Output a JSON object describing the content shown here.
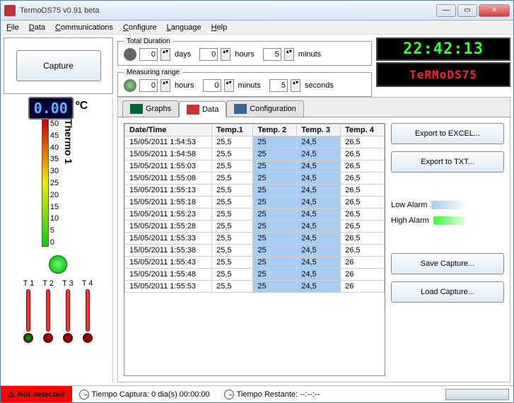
{
  "window": {
    "title": "TermoDS75 v0.91 beta"
  },
  "menu": {
    "file": "File",
    "data": "Data",
    "comm": "Communications",
    "config": "Configure",
    "lang": "Language",
    "help": "Help"
  },
  "toolbar": {
    "capture": "Capture"
  },
  "duration": {
    "total_legend": "Total Duration",
    "range_legend": "Measuring range",
    "days_lbl": "days",
    "hours_lbl": "hours",
    "minuts_lbl": "minuts",
    "seconds_lbl": "seconds",
    "total": {
      "days": "0",
      "hours": "0",
      "minuts": "5"
    },
    "range": {
      "hours": "0",
      "minuts": "0",
      "seconds": "5"
    }
  },
  "clock": {
    "time": "22:42:13"
  },
  "logo": {
    "text": "TeRMoDS75"
  },
  "thermo": {
    "reading": "0.00",
    "unit": "ºC",
    "label": "Thermo 1",
    "scale": [
      "50",
      "45",
      "40",
      "35",
      "30",
      "25",
      "20",
      "15",
      "10",
      "5",
      "0"
    ]
  },
  "minis": [
    {
      "label": "T 1",
      "color": "#0a0"
    },
    {
      "label": "T 2",
      "color": "#c00"
    },
    {
      "label": "T 3",
      "color": "#c00"
    },
    {
      "label": "T 4",
      "color": "#c00"
    }
  ],
  "tabs": {
    "graphs": "Graphs",
    "data": "Data",
    "config": "Configuration"
  },
  "table": {
    "headers": [
      "Date/Time",
      "Temp.1",
      "Temp. 2",
      "Temp. 3",
      "Temp. 4"
    ],
    "rows": [
      [
        "15/05/2011 1:54:53",
        "25,5",
        "25",
        "24,5",
        "26,5"
      ],
      [
        "15/05/2011 1:54:58",
        "25,5",
        "25",
        "24,5",
        "26,5"
      ],
      [
        "15/05/2011 1:55:03",
        "25,5",
        "25",
        "24,5",
        "26,5"
      ],
      [
        "15/05/2011 1:55:08",
        "25,5",
        "25",
        "24,5",
        "26,5"
      ],
      [
        "15/05/2011 1:55:13",
        "25,5",
        "25",
        "24,5",
        "26,5"
      ],
      [
        "15/05/2011 1:55:18",
        "25,5",
        "25",
        "24,5",
        "26,5"
      ],
      [
        "15/05/2011 1:55:23",
        "25,5",
        "25",
        "24,5",
        "26,5"
      ],
      [
        "15/05/2011 1:55:28",
        "25,5",
        "25",
        "24,5",
        "26,5"
      ],
      [
        "15/05/2011 1:55:33",
        "25,5",
        "25",
        "24,5",
        "26,5"
      ],
      [
        "15/05/2011 1:55:38",
        "25,5",
        "25",
        "24,5",
        "26,5"
      ],
      [
        "15/05/2011 1:55:43",
        "25,5",
        "25",
        "24,5",
        "26"
      ],
      [
        "15/05/2011 1:55:48",
        "25,5",
        "25",
        "24,5",
        "26"
      ],
      [
        "15/05/2011 1:55:53",
        "25,5",
        "25",
        "24,5",
        "26"
      ]
    ]
  },
  "buttons": {
    "excel": "Export to EXCEL...",
    "txt": "Export to TXT...",
    "save": "Save Capture...",
    "load": "Load Capture..."
  },
  "legend": {
    "low": "Low Alarm",
    "high": "High Alarm"
  },
  "status": {
    "notdetected": "Not detected",
    "captura": "Tiempo Captura: 0 dia(s) 00:00:00",
    "restante": "Tiempo Restante: --:--:--"
  }
}
